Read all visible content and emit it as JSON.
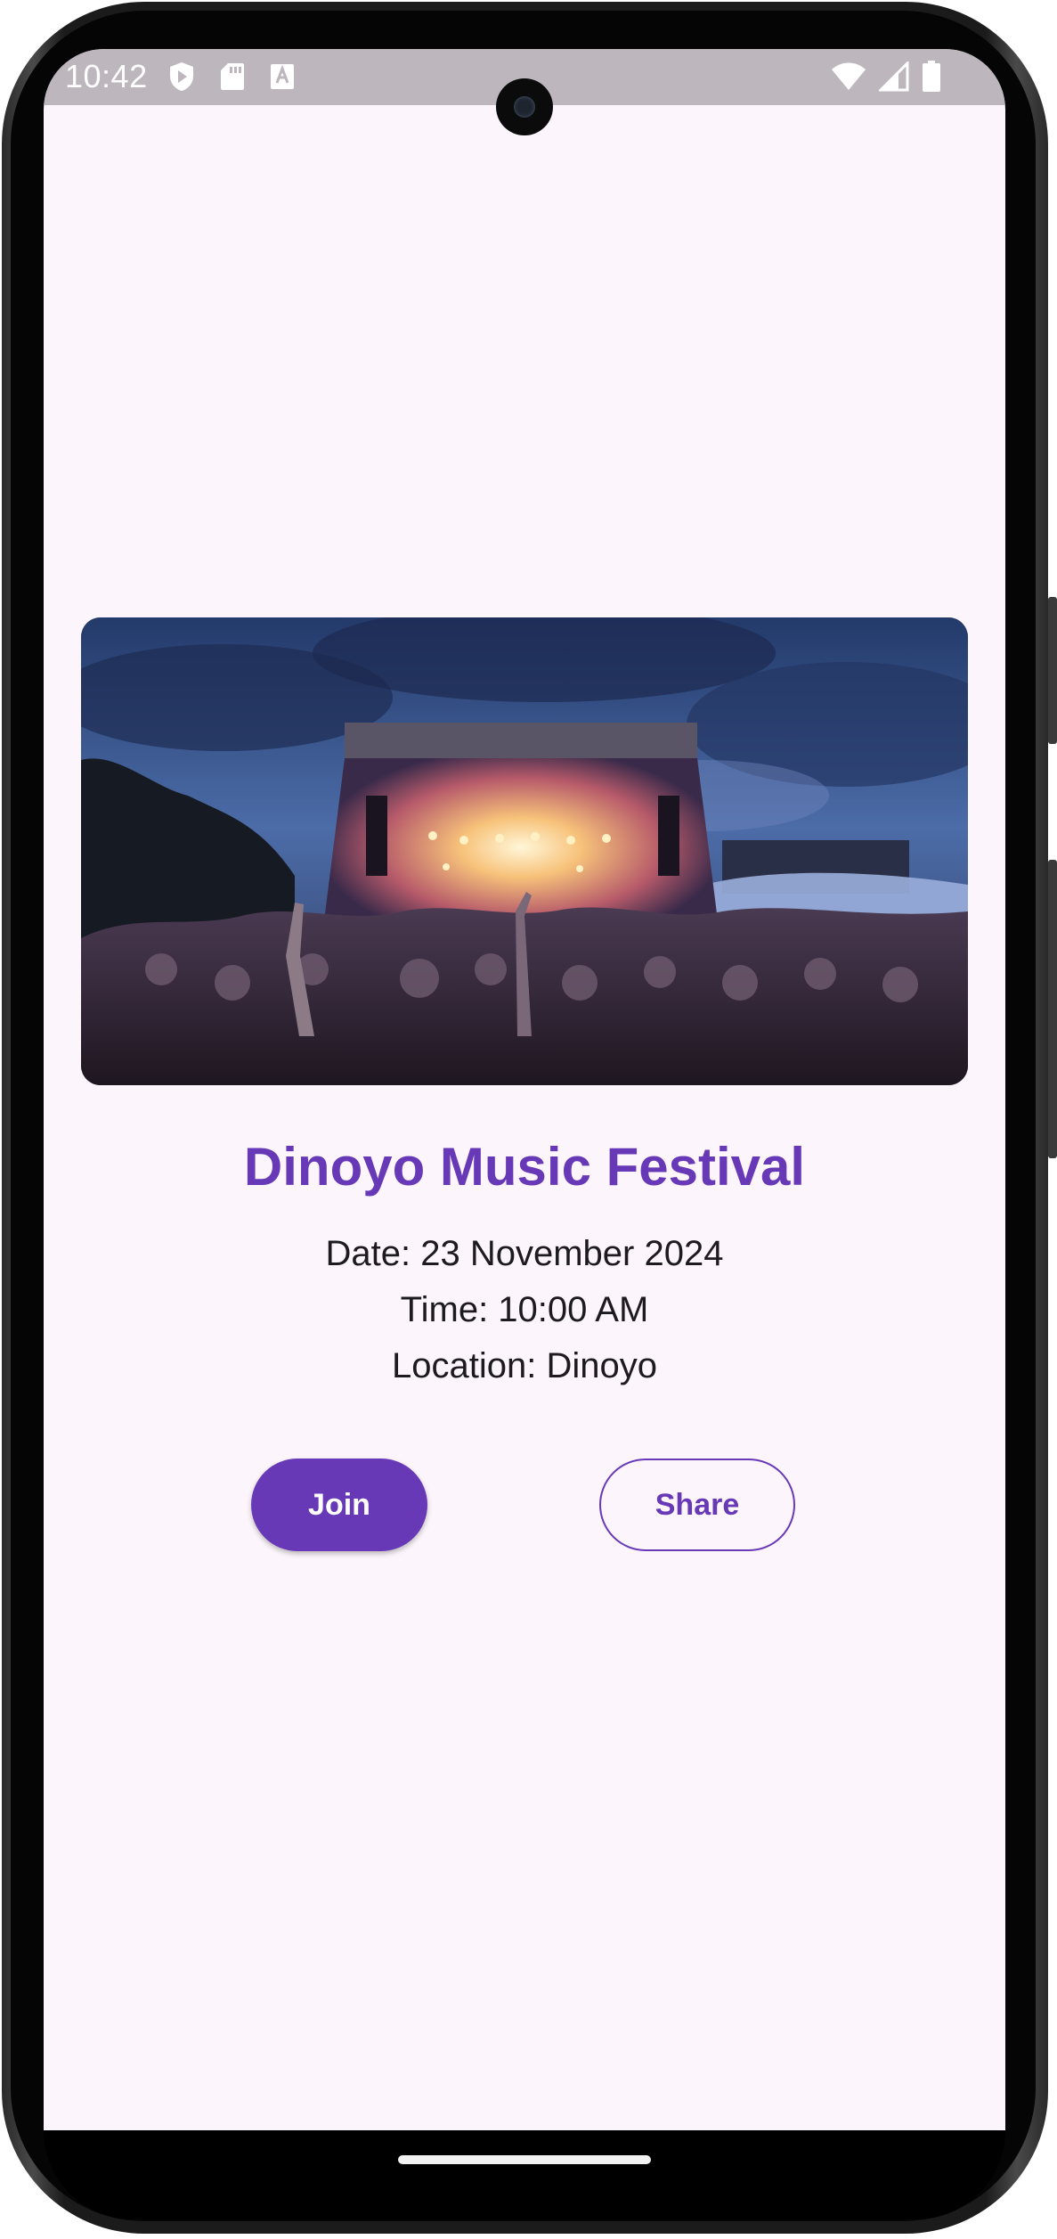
{
  "status_bar": {
    "time": "10:42",
    "left_icons": [
      "shield-play-icon",
      "sd-card-icon",
      "keyboard-a-icon"
    ],
    "right_icons": [
      "wifi-icon",
      "cell-signal-icon",
      "battery-icon"
    ]
  },
  "event": {
    "title": "Dinoyo Music Festival",
    "date": "Date: 23 November 2024",
    "time": "Time: 10:00 AM",
    "location": "Location: Dinoyo"
  },
  "actions": {
    "join_label": "Join",
    "share_label": "Share"
  },
  "colors": {
    "accent": "#6739b7",
    "background": "#fcf5fb",
    "text": "#1d1b20"
  }
}
